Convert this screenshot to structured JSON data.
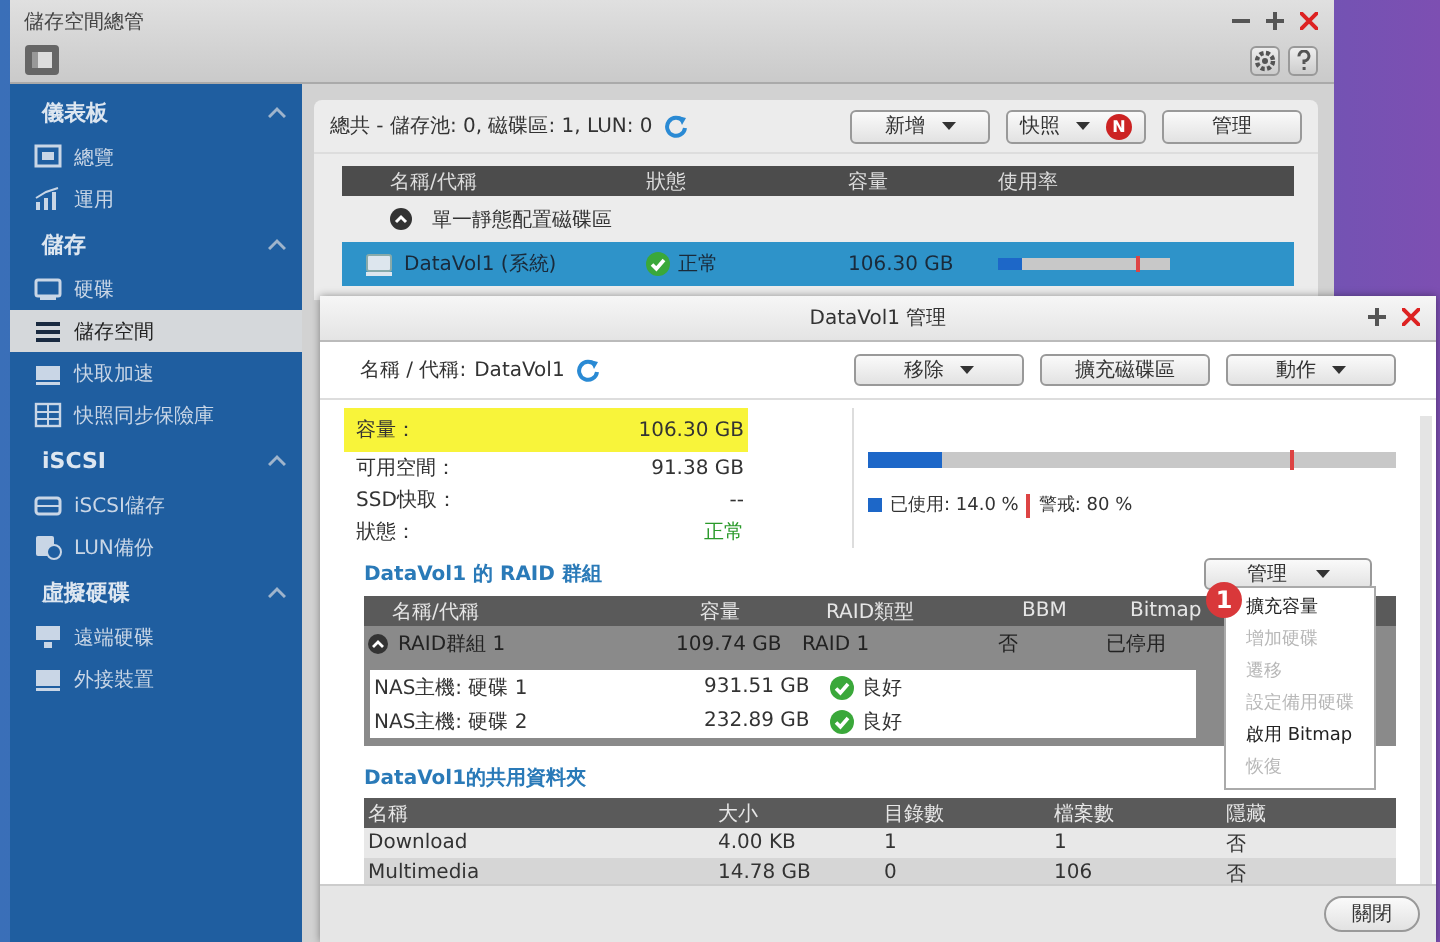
{
  "window": {
    "title": "儲存空間總管"
  },
  "sidebar": {
    "sections": [
      {
        "title": "儀表板",
        "expanded": true,
        "items": [
          {
            "label": "總覽",
            "selected": false
          },
          {
            "label": "運用",
            "selected": false
          }
        ]
      },
      {
        "title": "儲存",
        "expanded": true,
        "items": [
          {
            "label": "硬碟",
            "selected": false
          },
          {
            "label": "儲存空間",
            "selected": true
          },
          {
            "label": "快取加速",
            "selected": false
          },
          {
            "label": "快照同步保險庫",
            "selected": false
          }
        ]
      },
      {
        "title": "iSCSI",
        "expanded": true,
        "items": [
          {
            "label": "iSCSI儲存",
            "selected": false
          },
          {
            "label": "LUN備份",
            "selected": false
          }
        ]
      },
      {
        "title": "虛擬硬碟",
        "expanded": true,
        "items": [
          {
            "label": "遠端硬碟",
            "selected": false
          },
          {
            "label": "外接裝置",
            "selected": false
          }
        ]
      }
    ]
  },
  "summary": "總共 - 儲存池: 0, 磁碟區: 1, LUN: 0",
  "toolbar_buttons": [
    {
      "label": "新增",
      "dropdown": true
    },
    {
      "label": "快照",
      "dropdown": true,
      "badge": "N"
    },
    {
      "label": "管理",
      "dropdown": false
    }
  ],
  "volume_table": {
    "columns": [
      "名稱/代稱",
      "狀態",
      "容量",
      "使用率"
    ],
    "group": {
      "label": "單一靜態配置磁碟區",
      "expanded": true
    },
    "rows": [
      {
        "name": "DataVol1 (系統)",
        "status": "正常",
        "capacity": "106.30 GB",
        "usage": {
          "level": 0.14
        },
        "warning": {
          "level": 0.8
        },
        "selected": true
      }
    ]
  },
  "dialog": {
    "title": "DataVol1 管理",
    "name_label": "名稱 / 代稱:",
    "name_value": "DataVol1",
    "buttons": [
      {
        "label": "移除",
        "dropdown": true
      },
      {
        "label": "擴充磁碟區",
        "dropdown": false
      },
      {
        "label": "動作",
        "dropdown": true
      }
    ],
    "info": [
      {
        "label": "容量：",
        "value": "106.30 GB",
        "kind": "plain",
        "highlighted": true
      },
      {
        "label": "可用空間：",
        "value": "91.38 GB",
        "kind": "plain",
        "highlighted": false
      },
      {
        "label": "SSD快取：",
        "value": "--",
        "kind": "plain",
        "highlighted": false
      },
      {
        "label": "狀態：",
        "value": "正常",
        "kind": "status",
        "highlighted": false
      }
    ],
    "usage": {
      "level": 0.14
    },
    "warning": {
      "level": 0.8
    },
    "used_legend": "已使用: 14.0 %",
    "warning_legend": "警戒: 80 %",
    "raid_heading": "DataVol1 的 RAID 群組",
    "manage_button": "管理",
    "raid_table": {
      "columns": [
        "名稱/代稱",
        "容量",
        "RAID類型",
        "BBM",
        "Bitmap"
      ],
      "rows": [
        {
          "cells": [
            "RAID群組 1",
            "109.74 GB",
            "RAID 1",
            "否",
            "已停用"
          ],
          "expanded": true,
          "disks": [
            {
              "name": "NAS主機: 硬碟 1",
              "capacity": "931.51 GB",
              "status": "良好"
            },
            {
              "name": "NAS主機: 硬碟 2",
              "capacity": "232.89 GB",
              "status": "良好"
            }
          ]
        }
      ]
    },
    "menu": [
      {
        "label": "擴充容量",
        "disabled": false
      },
      {
        "label": "增加硬碟",
        "disabled": true
      },
      {
        "label": "遷移",
        "disabled": true
      },
      {
        "label": "設定備用硬碟",
        "disabled": true
      },
      {
        "label": "啟用 Bitmap",
        "disabled": false
      },
      {
        "label": "恢復",
        "disabled": true
      }
    ],
    "callout": "1",
    "share_heading": "DataVol1的共用資料夾",
    "share_table": {
      "columns": [
        "名稱",
        "大小",
        "目錄數",
        "檔案數",
        "隱藏"
      ],
      "rows": [
        [
          "Download",
          "4.00 KB",
          "1",
          "1",
          "否"
        ],
        [
          "Multimedia",
          "14.78 GB",
          "0",
          "106",
          "否"
        ]
      ]
    },
    "close_button": "關閉"
  }
}
